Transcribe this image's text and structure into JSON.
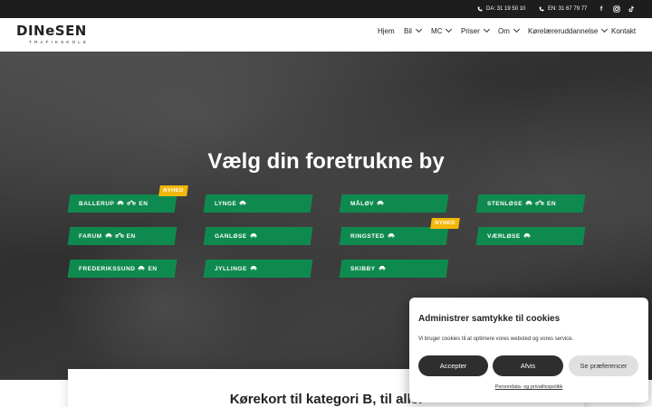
{
  "topbar": {
    "phone_da": "DA: 31 19 50 10",
    "phone_en": "EN: 31 67 79 77"
  },
  "logo": {
    "name": "DINeSEN",
    "subtitle": "TRAFIKSKOLE"
  },
  "nav": {
    "items": [
      {
        "label": "Hjem",
        "dropdown": false
      },
      {
        "label": "Bil",
        "dropdown": true
      },
      {
        "label": "MC",
        "dropdown": true
      },
      {
        "label": "Priser",
        "dropdown": true
      },
      {
        "label": "Om",
        "dropdown": true
      },
      {
        "label": "Kørelæreruddannelse",
        "dropdown": true
      },
      {
        "label": "Kontakt",
        "dropdown": false
      }
    ]
  },
  "hero": {
    "title": "Vælg din foretrukne by",
    "cities": [
      {
        "name": "BALLERUP",
        "icons": [
          "car",
          "motorcycle"
        ],
        "suffix": "EN",
        "badge": "NYHED"
      },
      {
        "name": "LYNGE",
        "icons": [
          "car"
        ],
        "suffix": "",
        "badge": ""
      },
      {
        "name": "MÅLØV",
        "icons": [
          "car"
        ],
        "suffix": "",
        "badge": ""
      },
      {
        "name": "STENLØSE",
        "icons": [
          "car",
          "motorcycle"
        ],
        "suffix": "EN",
        "badge": ""
      },
      {
        "name": "FARUM",
        "icons": [
          "car",
          "motorcycle"
        ],
        "suffix": "EN",
        "badge": ""
      },
      {
        "name": "GANLØSE",
        "icons": [
          "car"
        ],
        "suffix": "",
        "badge": ""
      },
      {
        "name": "RINGSTED",
        "icons": [
          "car"
        ],
        "suffix": "",
        "badge": "NYHED"
      },
      {
        "name": "VÆRLØSE",
        "icons": [
          "car"
        ],
        "suffix": "",
        "badge": ""
      },
      {
        "name": "FREDERIKSSUND",
        "icons": [
          "car"
        ],
        "suffix": "EN",
        "badge": ""
      },
      {
        "name": "JYLLINGE",
        "icons": [
          "car"
        ],
        "suffix": "",
        "badge": ""
      },
      {
        "name": "SKIBBY",
        "icons": [
          "car"
        ],
        "suffix": "",
        "badge": ""
      }
    ]
  },
  "section": {
    "title": "Kørekort til kategori B, til alle."
  },
  "cookie": {
    "title": "Administrer samtykke til cookies",
    "text": "Vi bruger cookies til at optimere vores websted og vores service.",
    "accept": "Accepter",
    "deny": "Afvis",
    "preferences": "Se præferencer",
    "policy": "Persondata- og privatlivspolitik"
  },
  "colors": {
    "brand_green": "#0f8a4f",
    "badge_yellow": "#f2b705",
    "topbar": "#1d1d1d"
  }
}
